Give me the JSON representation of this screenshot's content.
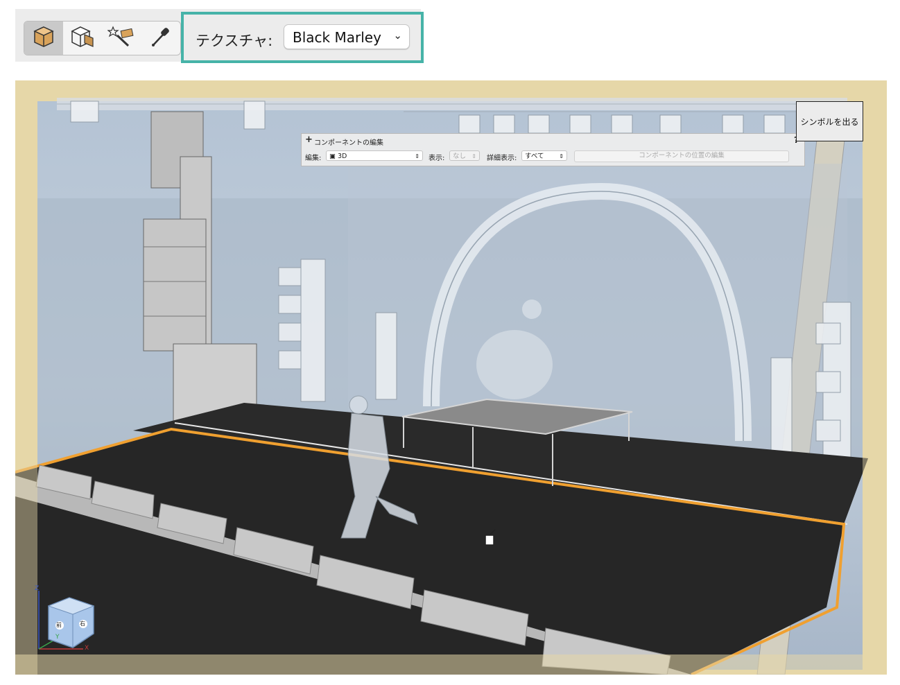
{
  "toolbar": {
    "tools": [
      {
        "icon": "solid-cube-icon",
        "active": true
      },
      {
        "icon": "wireframe-cube-icon",
        "active": false
      },
      {
        "icon": "magic-wand-texture-icon",
        "active": false
      },
      {
        "icon": "eyedropper-icon",
        "active": false
      }
    ],
    "texture_label": "テクスチャ:",
    "texture_value": "Black Marley",
    "highlight_color": "#46b3a8"
  },
  "component_panel": {
    "title": "コンポーネントの編集",
    "help": "?",
    "edit_label": "編集:",
    "edit_value": "3D",
    "display_label": "表示:",
    "display_value": "なし",
    "detail_label": "詳細表示:",
    "detail_value": "すべて",
    "position_button": "コンポーネントの位置の編集"
  },
  "exit_symbol_button": "シンボルを出る",
  "nav_cube": {
    "front_label": "前",
    "right_label": "右",
    "axis_x": "X",
    "axis_y": "Y",
    "axis_z": "Z"
  },
  "colors": {
    "stage_floor": "#262626",
    "selection_outline": "#f0a030",
    "overlay_tint": "#e6d7a8"
  }
}
